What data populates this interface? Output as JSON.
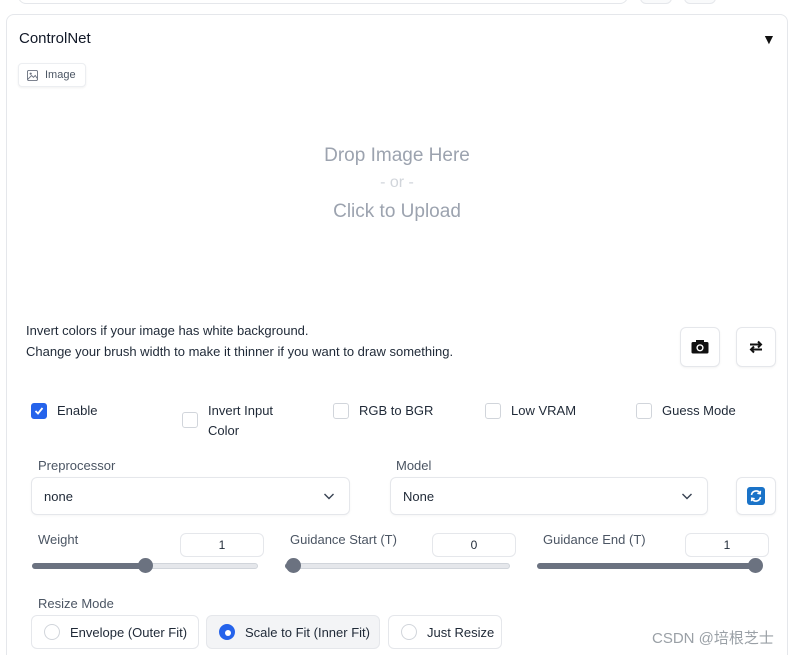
{
  "panel": {
    "title": "ControlNet",
    "collapse_icon": "▼",
    "tab_image_label": "Image"
  },
  "dropzone": {
    "line1": "Drop Image Here",
    "line2": "- or -",
    "line3": "Click to Upload"
  },
  "help": {
    "line1": "Invert colors if your image has white background.",
    "line2": "Change your brush width to make it thinner if you want to draw something."
  },
  "icons": {
    "camera": "camera-icon",
    "swap": "swap-arrows-icon",
    "refresh": "refresh-icon"
  },
  "checkboxes": [
    {
      "label": "Enable",
      "checked": true
    },
    {
      "label": "Invert Input Color",
      "checked": false
    },
    {
      "label": "RGB to BGR",
      "checked": false
    },
    {
      "label": "Low VRAM",
      "checked": false
    },
    {
      "label": "Guess Mode",
      "checked": false
    }
  ],
  "preprocessor": {
    "label": "Preprocessor",
    "value": "none"
  },
  "model": {
    "label": "Model",
    "value": "None"
  },
  "sliders": {
    "weight": {
      "label": "Weight",
      "value": "1",
      "fraction": 0.5
    },
    "guidance_start": {
      "label": "Guidance Start (T)",
      "value": "0",
      "fraction": 0.0
    },
    "guidance_end": {
      "label": "Guidance End (T)",
      "value": "1",
      "fraction": 1.0
    }
  },
  "resize_mode": {
    "label": "Resize Mode",
    "options": [
      "Envelope (Outer Fit)",
      "Scale to Fit (Inner Fit)",
      "Just Resize"
    ],
    "selected": "Scale to Fit (Inner Fit)"
  },
  "watermark": "CSDN @培根芝士",
  "colors": {
    "accent": "#2563eb"
  }
}
